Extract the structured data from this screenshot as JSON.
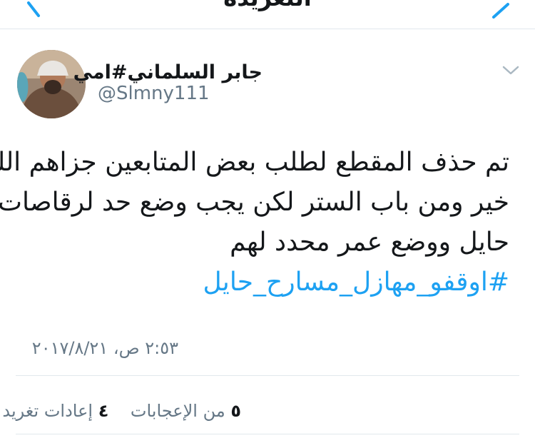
{
  "header": {
    "title": "التغريدة"
  },
  "tweet": {
    "display_name": "جابر السلماني#امي",
    "handle": "@Slmny111",
    "text_lines": [
      "تم حذف المقطع لطلب بعض المتابعين جزاهم الله",
      "خير ومن باب الستر لكن يجب وضع حد لرقاصات",
      "حايل ووضع عمر محدد لهم"
    ],
    "hashtag": "#اوقفو_مهازل_مسارح_حايل",
    "timestamp": "٢:٥٣ ص، ٢٠١٧/٨/٢١"
  },
  "stats": {
    "retweets_count": "٤",
    "retweets_label": "إعادات تغريد",
    "likes_count": "٥",
    "likes_label": "من الإعجابات"
  },
  "colors": {
    "link": "#1da1f2",
    "muted": "#657786",
    "divider": "#e1e8ed"
  },
  "icons": {
    "back": "chevron-right-icon",
    "forward": "chevron-left-icon",
    "menu": "chevron-down-icon"
  }
}
